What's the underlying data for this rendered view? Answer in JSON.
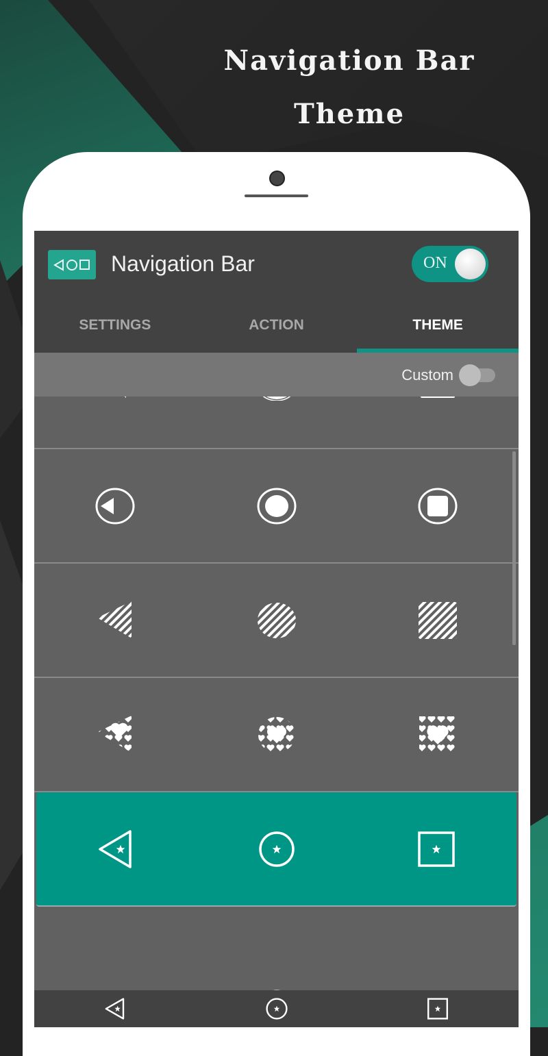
{
  "promo": {
    "headline_line1": "Navigation Bar",
    "headline_line2": "Theme"
  },
  "app": {
    "title": "Navigation Bar",
    "icon": "nav-buttons-icon",
    "master_toggle": {
      "label": "ON",
      "state": true
    }
  },
  "tabs": [
    {
      "label": "SETTINGS",
      "active": false
    },
    {
      "label": "ACTION",
      "active": false
    },
    {
      "label": "THEME",
      "active": true
    }
  ],
  "custom_toggle": {
    "label": "Custom",
    "state": false
  },
  "themes": [
    {
      "name": "solid",
      "icons": [
        "back-triangle-solid-icon",
        "home-circle-solid-icon",
        "recent-square-solid-icon"
      ],
      "selected": false,
      "partially_visible": true
    },
    {
      "name": "ringed",
      "icons": [
        "back-ringed-icon",
        "home-ringed-icon",
        "recent-ringed-icon"
      ],
      "selected": false
    },
    {
      "name": "striped",
      "icons": [
        "back-striped-icon",
        "home-striped-icon",
        "recent-striped-icon"
      ],
      "selected": false
    },
    {
      "name": "hearts",
      "icons": [
        "back-hearts-icon",
        "home-hearts-icon",
        "recent-hearts-icon"
      ],
      "selected": false
    },
    {
      "name": "star-outline",
      "icons": [
        "back-star-icon",
        "home-star-icon",
        "recent-star-icon"
      ],
      "selected": true
    },
    {
      "name": "hearts-outline",
      "icons": [
        "back-hearts-outline-icon",
        "home-hearts-outline-icon",
        "recent-hearts-outline-icon"
      ],
      "selected": false,
      "partially_visible": true
    }
  ],
  "system_navbar": {
    "icons": [
      "back-star-icon",
      "home-star-icon",
      "recent-star-icon"
    ]
  },
  "colors": {
    "accent": "#0e9385",
    "selected_row": "#009686",
    "appbar": "#424242",
    "list_bg": "#616161"
  }
}
